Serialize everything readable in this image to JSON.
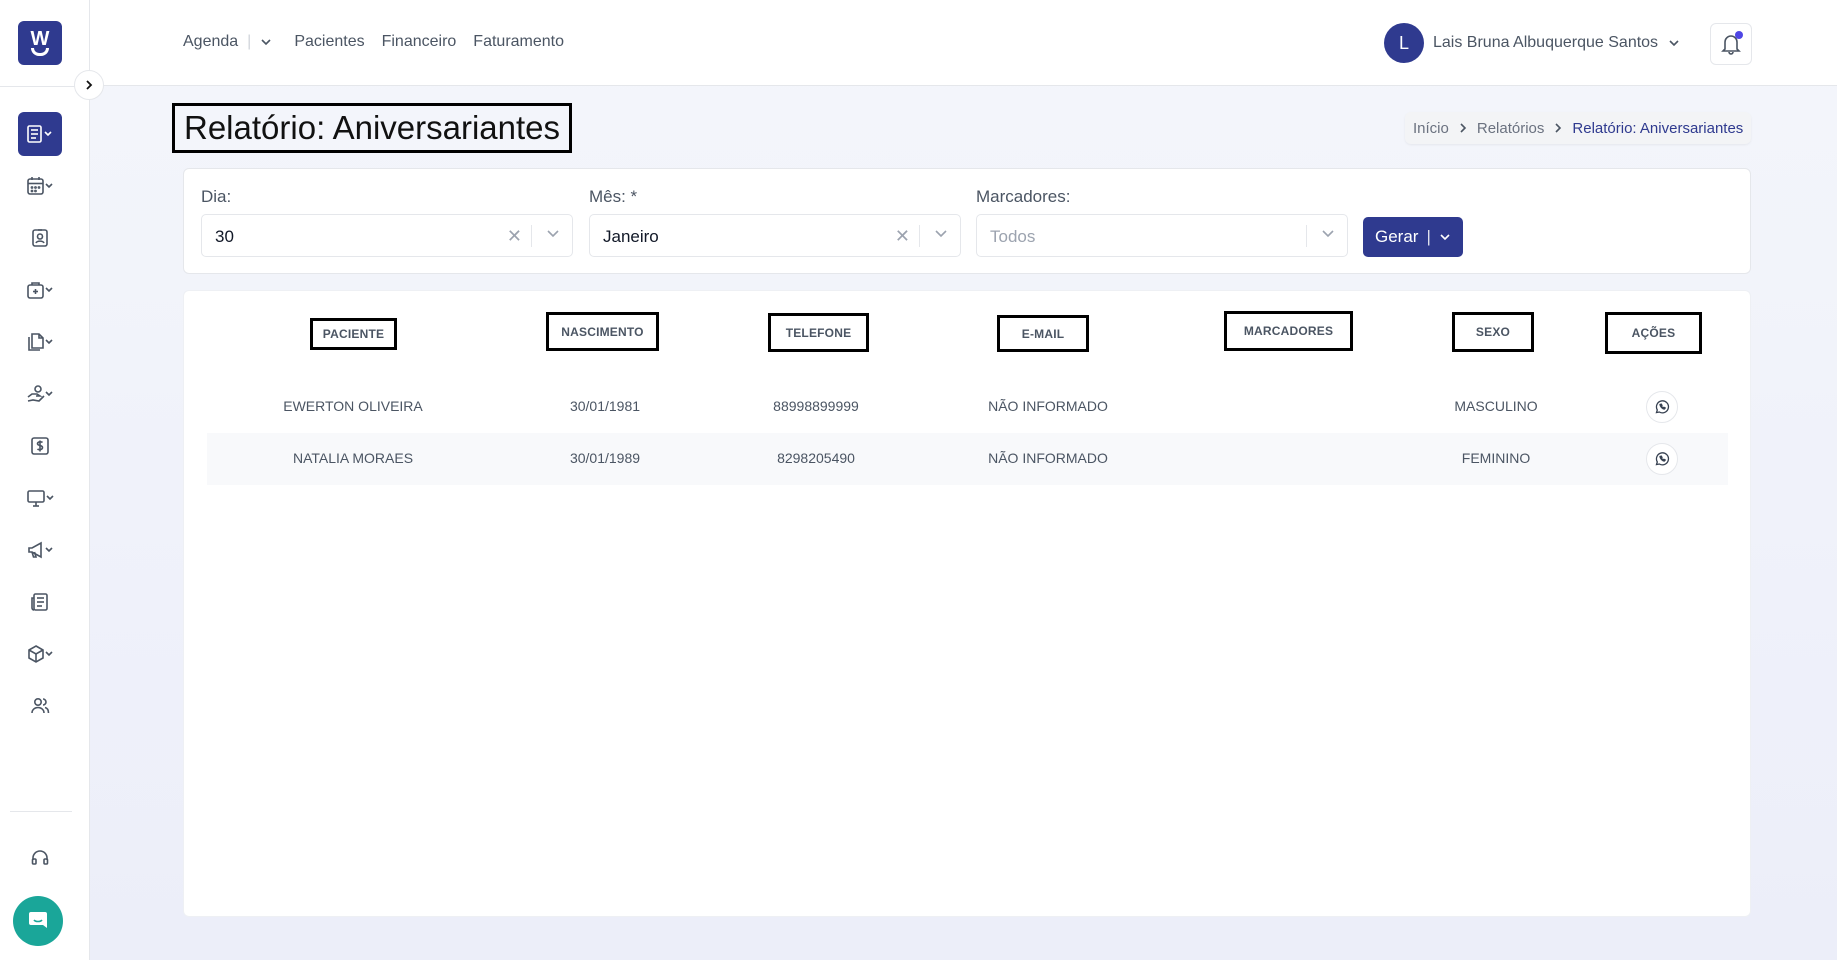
{
  "brand": {
    "logo_letter": "W"
  },
  "sidebar": {
    "items": [
      {
        "icon": "reports-icon",
        "active": true,
        "has_dropdown": true
      },
      {
        "icon": "calendar-icon",
        "active": false,
        "has_dropdown": true
      },
      {
        "icon": "patient-id-icon",
        "active": false,
        "has_dropdown": false
      },
      {
        "icon": "medical-bag-icon",
        "active": false,
        "has_dropdown": true
      },
      {
        "icon": "documents-icon",
        "active": false,
        "has_dropdown": true
      },
      {
        "icon": "hand-money-icon",
        "active": false,
        "has_dropdown": true
      },
      {
        "icon": "dollar-icon",
        "active": false,
        "has_dropdown": false
      },
      {
        "icon": "monitor-icon",
        "active": false,
        "has_dropdown": true
      },
      {
        "icon": "megaphone-icon",
        "active": false,
        "has_dropdown": true
      },
      {
        "icon": "newspaper-icon",
        "active": false,
        "has_dropdown": false
      },
      {
        "icon": "package-icon",
        "active": false,
        "has_dropdown": true
      },
      {
        "icon": "users-icon",
        "active": false,
        "has_dropdown": false
      }
    ],
    "support_icon": "headset-icon",
    "chat_icon": "chat-icon"
  },
  "topnav": {
    "items": [
      "Agenda",
      "Pacientes",
      "Financeiro",
      "Faturamento"
    ],
    "user": {
      "initial": "L",
      "name": "Lais Bruna Albuquerque Santos"
    }
  },
  "page": {
    "title": "Relatório: Aniversariantes",
    "breadcrumb": [
      "Início",
      "Relatórios",
      "Relatório: Aniversariantes"
    ]
  },
  "filters": {
    "dia": {
      "label": "Dia:",
      "value": "30"
    },
    "mes": {
      "label": "Mês: *",
      "value": "Janeiro"
    },
    "marcadores": {
      "label": "Marcadores:",
      "placeholder": "Todos"
    },
    "generate_label": "Gerar",
    "generate_separator": "|"
  },
  "table": {
    "columns": [
      "PACIENTE",
      "NASCIMENTO",
      "TELEFONE",
      "E-MAIL",
      "MARCADORES",
      "SEXO",
      "AÇÕES"
    ],
    "rows": [
      {
        "paciente": "EWERTON OLIVEIRA",
        "nascimento": "30/01/1981",
        "telefone": "88998899999",
        "email": "NÃO INFORMADO",
        "marcadores": "",
        "sexo": "MASCULINO",
        "acao_icon": "whatsapp-icon"
      },
      {
        "paciente": "NATALIA MORAES",
        "nascimento": "30/01/1989",
        "telefone": "8298205490",
        "email": "NÃO INFORMADO",
        "marcadores": "",
        "sexo": "FEMININO",
        "acao_icon": "whatsapp-icon"
      }
    ]
  },
  "colors": {
    "primary": "#2f3a8f",
    "chat": "#1aa699",
    "notification_dot": "#4f46e5"
  }
}
